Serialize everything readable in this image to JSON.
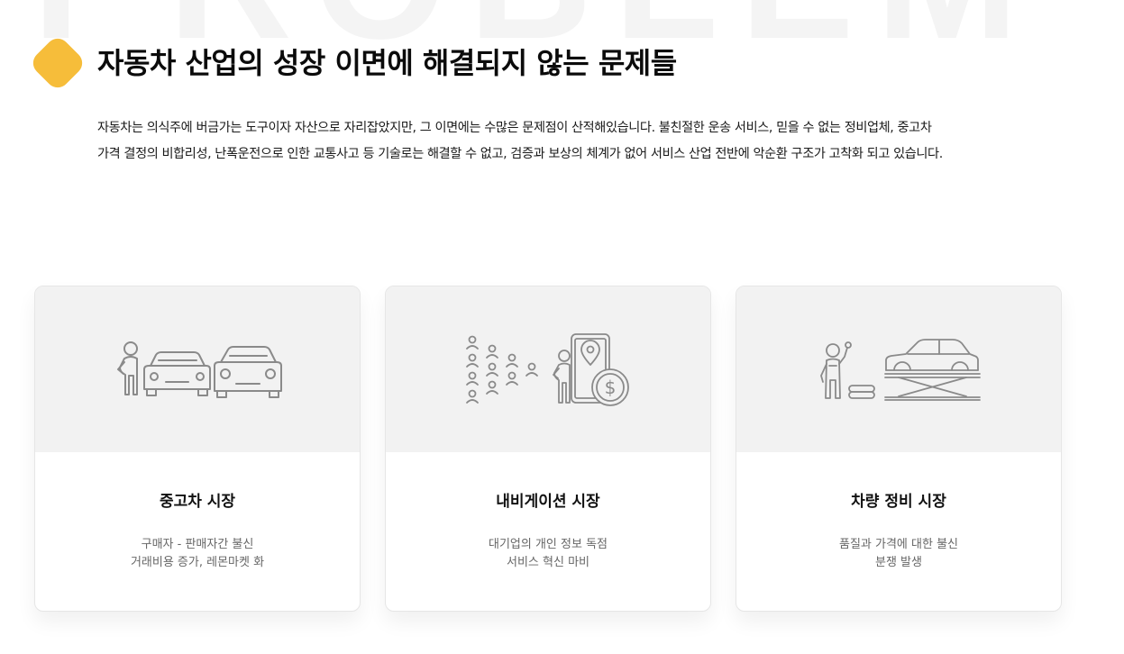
{
  "section": {
    "watermark": "PROBLEM",
    "title": "자동차 산업의 성장 이면에 해결되지 않는 문제들",
    "intro_lines": [
      "자동차는 의식주에 버금가는 도구이자 자산으로 자리잡았지만, 그 이면에는 수많은 문제점이 산적해있습니다. 불친절한 운송 서비스, 믿을 수 없는 정비업체, 중고차",
      "가격 결정의 비합리성, 난폭운전으로 인한 교통사고 등 기술로는 해결할 수 없고, 검증과 보상의 체계가 없어 서비스 산업 전반에 악순환 구조가 고착화 되고 있습니다."
    ],
    "accent_color": "#f6bd3a"
  },
  "cards": [
    {
      "title": "중고차 시장",
      "desc": [
        "구매자 - 판매자간 불신",
        "거래비용 증가, 레몬마켓 화"
      ],
      "icon": "person-and-cars-icon"
    },
    {
      "title": "내비게이션 시장",
      "desc": [
        "대기업의 개인 정보 독점",
        "서비스 혁신 마비"
      ],
      "icon": "people-phone-location-dollar-icon"
    },
    {
      "title": "차량 정비 시장",
      "desc": [
        "품질과 가격에 대한 불신",
        "분쟁 발생"
      ],
      "icon": "mechanic-car-lift-icon"
    }
  ]
}
